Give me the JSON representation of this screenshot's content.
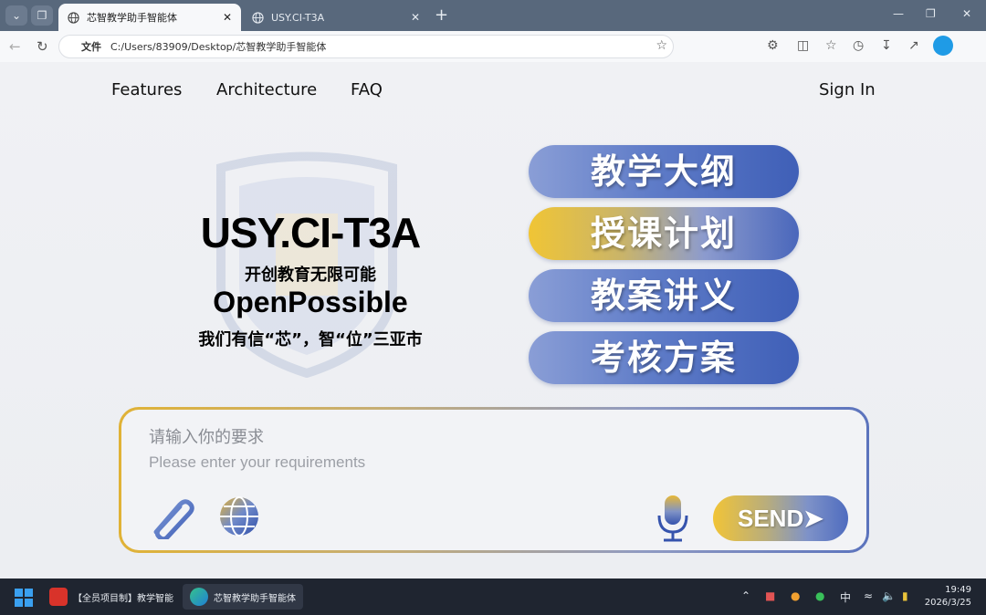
{
  "browser": {
    "tabs": [
      {
        "title": "芯智教学助手智能体",
        "active": true
      },
      {
        "title": "USY.CI-T3A",
        "active": false
      }
    ],
    "address": {
      "scheme_label": "文件",
      "url": "C:/Users/83909/Desktop/芯智教学助手智能体"
    }
  },
  "nav": {
    "links": [
      "Features",
      "Architecture",
      "FAQ"
    ],
    "sign_in": "Sign In"
  },
  "hero": {
    "title": "USY.CI-T3A",
    "subtitle_cn": "开创教育无限可能",
    "subtitle_en": "OpenPossible",
    "slogan": "我们有信“芯”，智“位”三亚市"
  },
  "menu": {
    "items": [
      "教学大纲",
      "授课计划",
      "教案讲义",
      "考核方案"
    ],
    "highlighted_index": 1
  },
  "input": {
    "placeholder_cn": "请输入你的要求",
    "placeholder_en": "Please enter your requirements",
    "send_label": "SEND➤"
  },
  "taskbar": {
    "apps": [
      {
        "label": "【全员项目制】教学智能",
        "icon": "wps-icon"
      },
      {
        "label": "芯智教学助手智能体",
        "icon": "edge-icon",
        "active": true
      }
    ],
    "ime": "中",
    "time": "19:49",
    "date": "2026/3/25"
  },
  "colors": {
    "button_blue": "#5f7cc8",
    "highlight_gold": "#f0c535",
    "taskbar": "#1f2530",
    "tabbar": "#58687c"
  }
}
